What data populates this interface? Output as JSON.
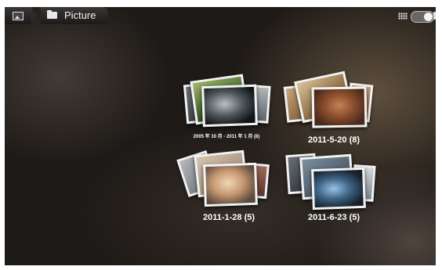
{
  "breadcrumb": {
    "home_icon": "image-icon",
    "folder_icon": "folder-icon",
    "folder_label": "Picture"
  },
  "topbar": {
    "view_icon": "grid-view-icon",
    "toggle": "camera-gallery-toggle"
  },
  "albums": [
    {
      "label": "2005 年 10 月 - 2011 年 1 月 (8)"
    },
    {
      "label": "2011-5-20  (8)"
    },
    {
      "label": "2011-1-28  (5)"
    },
    {
      "label": "2011-6-23  (5)"
    }
  ]
}
